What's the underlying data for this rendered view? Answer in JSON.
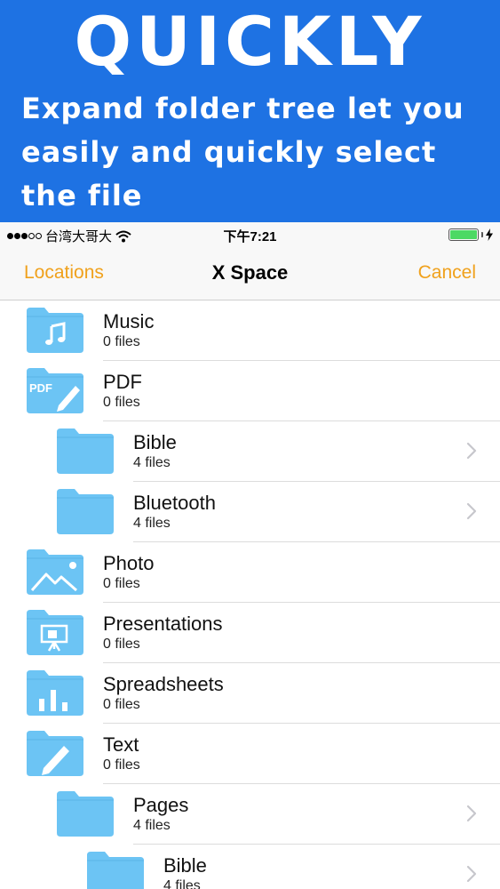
{
  "banner": {
    "title": "QUICKLY",
    "subtitle_lines": [
      "Expand folder tree let you",
      "easily and quickly select",
      "the file"
    ]
  },
  "status_bar": {
    "carrier": "台湾大哥大",
    "time": "下午7:21",
    "battery_level": 1.0,
    "battery_color": "#4cd964"
  },
  "nav": {
    "left": "Locations",
    "title": "X Space",
    "right": "Cancel"
  },
  "colors": {
    "banner_bg": "#1e72e3",
    "accent": "#f0a11c",
    "folder": "#6cc4f4"
  },
  "rows": [
    {
      "name": "Music",
      "count": "0 files",
      "level": 0,
      "icon": "music-folder-icon",
      "chevron": false
    },
    {
      "name": "PDF",
      "count": "0 files",
      "level": 0,
      "icon": "pdf-folder-icon",
      "chevron": false
    },
    {
      "name": "Bible",
      "count": "4 files",
      "level": 1,
      "icon": "folder-icon",
      "chevron": true
    },
    {
      "name": "Bluetooth",
      "count": "4 files",
      "level": 1,
      "icon": "folder-icon",
      "chevron": true
    },
    {
      "name": "Photo",
      "count": "0 files",
      "level": 0,
      "icon": "photo-folder-icon",
      "chevron": false
    },
    {
      "name": "Presentations",
      "count": "0 files",
      "level": 0,
      "icon": "presentation-folder-icon",
      "chevron": false
    },
    {
      "name": "Spreadsheets",
      "count": "0 files",
      "level": 0,
      "icon": "spreadsheet-folder-icon",
      "chevron": false
    },
    {
      "name": "Text",
      "count": "0 files",
      "level": 0,
      "icon": "text-folder-icon",
      "chevron": false
    },
    {
      "name": "Pages",
      "count": "4 files",
      "level": 1,
      "icon": "folder-icon",
      "chevron": true
    },
    {
      "name": "Bible",
      "count": "4 files",
      "level": 2,
      "icon": "folder-icon",
      "chevron": true
    }
  ]
}
